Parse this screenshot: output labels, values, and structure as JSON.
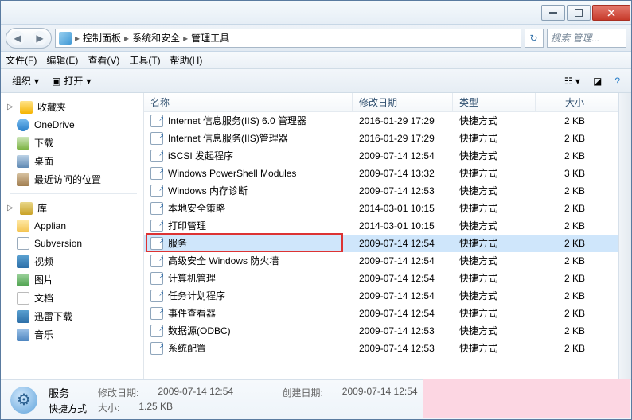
{
  "titlebar": {
    "min_tip": "最小化",
    "max_tip": "最大化",
    "close_tip": "关闭"
  },
  "breadcrumbs": [
    "控制面板",
    "系统和安全",
    "管理工具"
  ],
  "search_placeholder": "搜索 管理...",
  "menus": {
    "file": "文件(F)",
    "edit": "编辑(E)",
    "view": "查看(V)",
    "tools": "工具(T)",
    "help": "帮助(H)"
  },
  "toolbar": {
    "organize": "组织",
    "open": "打开"
  },
  "sidebar": {
    "favorites_label": "收藏夹",
    "onedrive": "OneDrive",
    "downloads": "下载",
    "desktop": "桌面",
    "recent": "最近访问的位置",
    "libraries_label": "库",
    "applian": "Applian",
    "subversion": "Subversion",
    "videos": "视频",
    "pictures": "图片",
    "documents": "文档",
    "xunlei": "迅雷下载",
    "music": "音乐"
  },
  "columns": {
    "name": "名称",
    "date": "修改日期",
    "type": "类型",
    "size": "大小"
  },
  "rows": [
    {
      "name": "Internet 信息服务(IIS) 6.0 管理器",
      "date": "2016-01-29 17:29",
      "type": "快捷方式",
      "size": "2 KB"
    },
    {
      "name": "Internet 信息服务(IIS)管理器",
      "date": "2016-01-29 17:29",
      "type": "快捷方式",
      "size": "2 KB"
    },
    {
      "name": "iSCSI 发起程序",
      "date": "2009-07-14 12:54",
      "type": "快捷方式",
      "size": "2 KB"
    },
    {
      "name": "Windows PowerShell Modules",
      "date": "2009-07-14 13:32",
      "type": "快捷方式",
      "size": "3 KB"
    },
    {
      "name": "Windows 内存诊断",
      "date": "2009-07-14 12:53",
      "type": "快捷方式",
      "size": "2 KB"
    },
    {
      "name": "本地安全策略",
      "date": "2014-03-01 10:15",
      "type": "快捷方式",
      "size": "2 KB"
    },
    {
      "name": "打印管理",
      "date": "2014-03-01 10:15",
      "type": "快捷方式",
      "size": "2 KB"
    },
    {
      "name": "服务",
      "date": "2009-07-14 12:54",
      "type": "快捷方式",
      "size": "2 KB",
      "selected": true,
      "highlight": true
    },
    {
      "name": "高级安全 Windows 防火墙",
      "date": "2009-07-14 12:54",
      "type": "快捷方式",
      "size": "2 KB"
    },
    {
      "name": "计算机管理",
      "date": "2009-07-14 12:54",
      "type": "快捷方式",
      "size": "2 KB"
    },
    {
      "name": "任务计划程序",
      "date": "2009-07-14 12:54",
      "type": "快捷方式",
      "size": "2 KB"
    },
    {
      "name": "事件查看器",
      "date": "2009-07-14 12:54",
      "type": "快捷方式",
      "size": "2 KB"
    },
    {
      "name": "数据源(ODBC)",
      "date": "2009-07-14 12:53",
      "type": "快捷方式",
      "size": "2 KB"
    },
    {
      "name": "系统配置",
      "date": "2009-07-14 12:53",
      "type": "快捷方式",
      "size": "2 KB"
    }
  ],
  "details": {
    "title": "服务",
    "type_label": "快捷方式",
    "modified_label": "修改日期:",
    "modified_value": "2009-07-14 12:54",
    "created_label": "创建日期:",
    "created_value": "2009-07-14 12:54",
    "size_label": "大小:",
    "size_value": "1.25 KB"
  }
}
